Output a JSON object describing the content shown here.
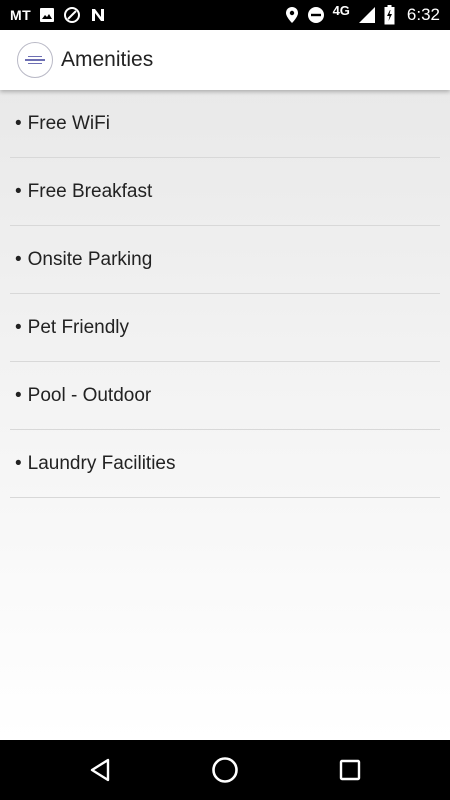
{
  "status_bar": {
    "carrier": "MT",
    "network": "4G",
    "time": "6:32",
    "icons": [
      "image-icon",
      "data-saver-icon",
      "n-icon",
      "location-icon",
      "do-not-disturb-icon",
      "signal-icon",
      "battery-charging-icon"
    ]
  },
  "app_bar": {
    "title": "Amenities",
    "logo_icon": "hotel-logo-icon"
  },
  "amenities": [
    {
      "bullet": "•",
      "label": "Free WiFi"
    },
    {
      "bullet": "•",
      "label": "Free Breakfast"
    },
    {
      "bullet": "•",
      "label": "Onsite Parking"
    },
    {
      "bullet": "•",
      "label": "Pet Friendly"
    },
    {
      "bullet": "•",
      "label": "Pool - Outdoor"
    },
    {
      "bullet": "•",
      "label": "Laundry Facilities"
    }
  ],
  "nav_bar": {
    "icons": [
      "back-icon",
      "home-icon",
      "recents-icon"
    ]
  },
  "colors": {
    "status_bar_bg": "#000000",
    "app_bar_bg": "#ffffff",
    "content_bg": "#e9e9e9",
    "divider": "#d8d8d8",
    "text": "#222222"
  }
}
